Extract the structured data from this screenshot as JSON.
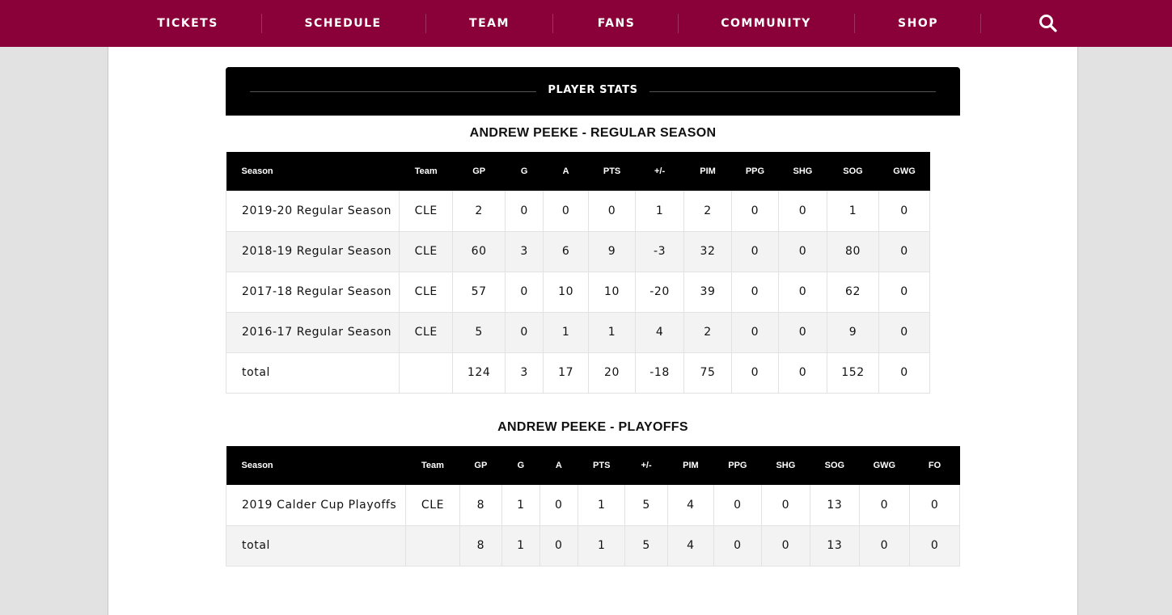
{
  "nav": {
    "items": [
      "TICKETS",
      "SCHEDULE",
      "TEAM",
      "FANS",
      "COMMUNITY",
      "SHOP"
    ],
    "search_icon": "search-icon"
  },
  "stats_header": {
    "title": "PLAYER STATS"
  },
  "regular_season": {
    "title": "ANDREW PEEKE - REGULAR SEASON",
    "columns": [
      "Season",
      "Team",
      "GP",
      "G",
      "A",
      "PTS",
      "+/-",
      "PIM",
      "PPG",
      "SHG",
      "SOG",
      "GWG"
    ],
    "rows": [
      [
        "2019-20 Regular Season",
        "CLE",
        "2",
        "0",
        "0",
        "0",
        "1",
        "2",
        "0",
        "0",
        "1",
        "0"
      ],
      [
        "2018-19 Regular Season",
        "CLE",
        "60",
        "3",
        "6",
        "9",
        "-3",
        "32",
        "0",
        "0",
        "80",
        "0"
      ],
      [
        "2017-18 Regular Season",
        "CLE",
        "57",
        "0",
        "10",
        "10",
        "-20",
        "39",
        "0",
        "0",
        "62",
        "0"
      ],
      [
        "2016-17 Regular Season",
        "CLE",
        "5",
        "0",
        "1",
        "1",
        "4",
        "2",
        "0",
        "0",
        "9",
        "0"
      ],
      [
        "total",
        "",
        "124",
        "3",
        "17",
        "20",
        "-18",
        "75",
        "0",
        "0",
        "152",
        "0"
      ]
    ]
  },
  "playoffs": {
    "title": "ANDREW PEEKE - PLAYOFFS",
    "columns": [
      "Season",
      "Team",
      "GP",
      "G",
      "A",
      "PTS",
      "+/-",
      "PIM",
      "PPG",
      "SHG",
      "SOG",
      "GWG",
      "FO"
    ],
    "rows": [
      [
        "2019 Calder Cup Playoffs",
        "CLE",
        "8",
        "1",
        "0",
        "1",
        "5",
        "4",
        "0",
        "0",
        "13",
        "0",
        "0"
      ],
      [
        "total",
        "",
        "8",
        "1",
        "0",
        "1",
        "5",
        "4",
        "0",
        "0",
        "13",
        "0",
        "0"
      ]
    ]
  },
  "colors": {
    "nav_bg": "#8a0039",
    "header_bg": "#000000",
    "row_alt": "#f3f3f3"
  }
}
